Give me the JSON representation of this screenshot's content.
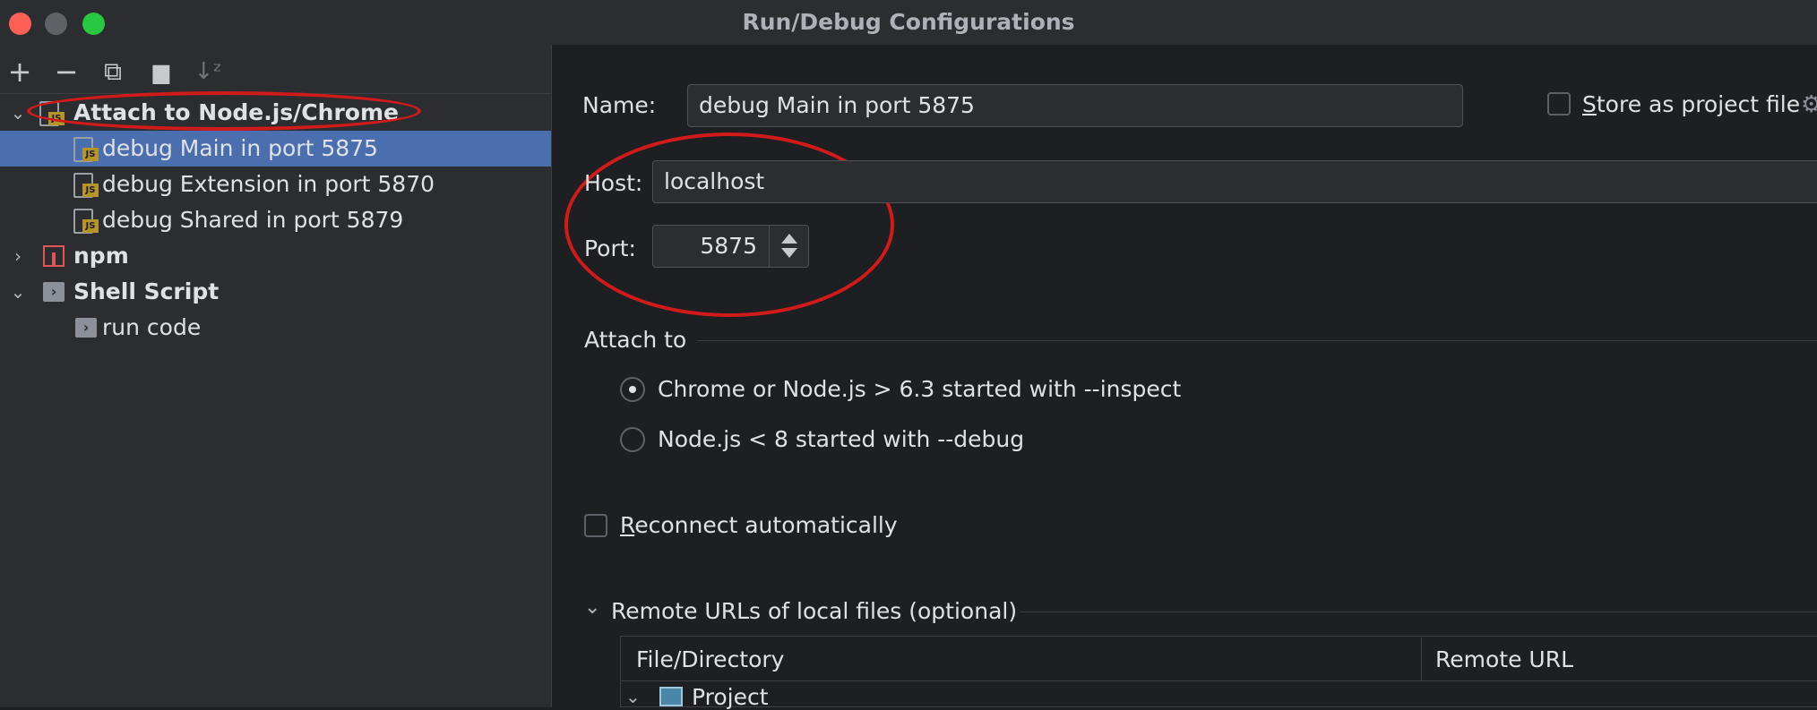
{
  "window": {
    "title": "Run/Debug Configurations"
  },
  "toolbar": {
    "add": "+",
    "remove": "−",
    "copy": "⧉",
    "folder": "▆",
    "sort": "↓ᶻ"
  },
  "tree": {
    "items": [
      {
        "label": "Attach to Node.js/Chrome",
        "icon": "js-config-icon",
        "expanded": true
      },
      {
        "label": "debug Main in port 5875",
        "icon": "js-config-icon",
        "selected": true
      },
      {
        "label": "debug Extension in port 5870",
        "icon": "js-config-icon"
      },
      {
        "label": "debug Shared in port 5879",
        "icon": "js-config-icon"
      },
      {
        "label": "npm",
        "icon": "npm-icon",
        "expanded": false
      },
      {
        "label": "Shell Script",
        "icon": "shell-script-icon",
        "expanded": true
      },
      {
        "label": "run code",
        "icon": "shell-script-icon"
      }
    ]
  },
  "form": {
    "name_label": "Name:",
    "name_value": "debug Main in port 5875",
    "store_label_prefix": "S",
    "store_label_rest": "tore as project file",
    "host_label": "Host:",
    "host_value": "localhost",
    "port_label": "Port:",
    "port_value": "5875",
    "attach_to_label": "Attach to",
    "radio_inspect": "Chrome or Node.js > 6.3 started with --inspect",
    "radio_debug": "Node.js < 8 started with --debug",
    "reconnect_prefix": "R",
    "reconnect_rest": "econnect automatically",
    "remote_urls_label": "Remote URLs of local files (optional)",
    "col_file": "File/Directory",
    "col_remote": "Remote URL",
    "project_row": "Project"
  },
  "colors": {
    "selection": "#4b6eaf",
    "annotation": "#d11a1a",
    "js_badge": "#b7932b",
    "npm": "#e05555"
  },
  "state": {
    "attach_mode": "inspect",
    "store_as_project_file": false,
    "reconnect_automatically": false
  }
}
